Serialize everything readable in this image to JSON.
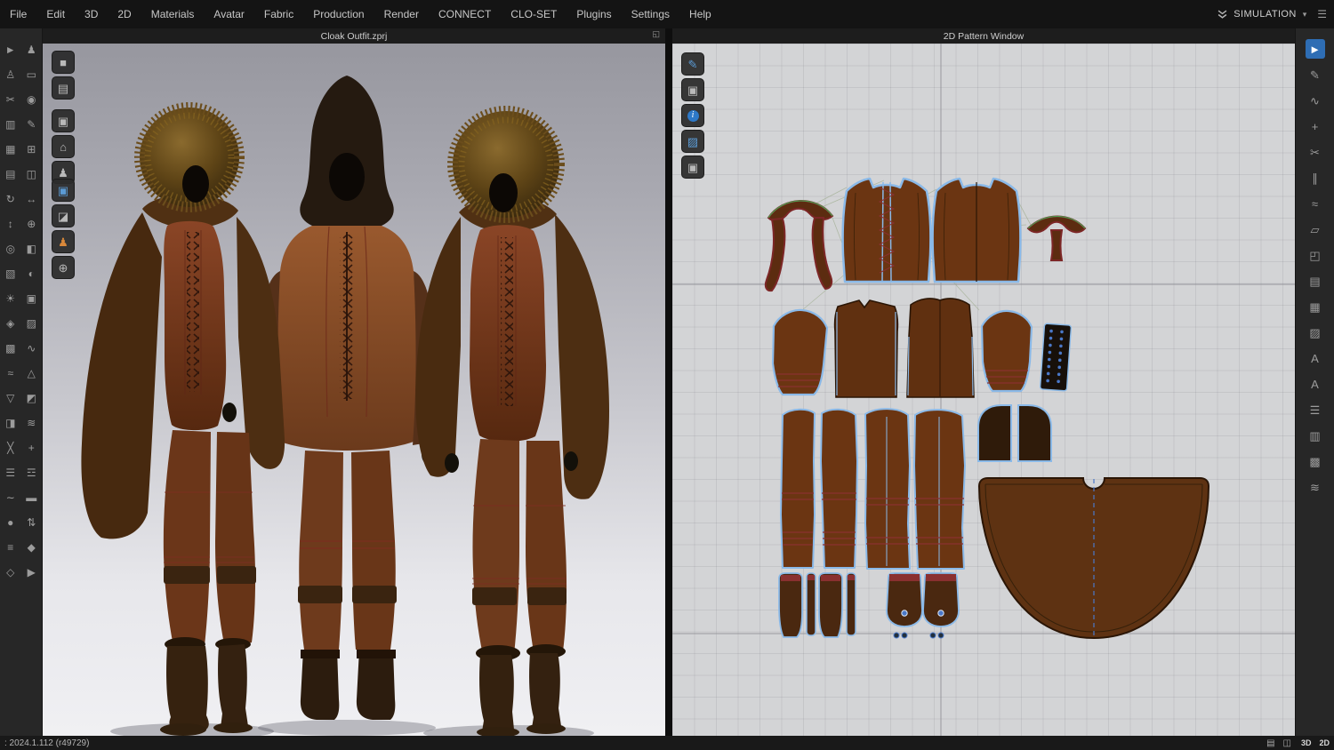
{
  "colors": {
    "accent": "#2e6db4",
    "grid_bg": "#d3d4d6",
    "pattern_outline_blue": "#8ab9e8",
    "leather_brown": "#6b3512",
    "leather_dark": "#3a2008",
    "cloak_brown": "#5e3212",
    "seam_red": "#8a3030",
    "eyelet_blue": "#4a78c8",
    "fur_brown": "#6a4d1e",
    "relation_green": "#4e9a4e"
  },
  "menubar": {
    "items": [
      {
        "name": "menu-file",
        "label": "File"
      },
      {
        "name": "menu-edit",
        "label": "Edit"
      },
      {
        "name": "menu-3d",
        "label": "3D"
      },
      {
        "name": "menu-2d",
        "label": "2D"
      },
      {
        "name": "menu-materials",
        "label": "Materials"
      },
      {
        "name": "menu-avatar",
        "label": "Avatar"
      },
      {
        "name": "menu-fabric",
        "label": "Fabric"
      },
      {
        "name": "menu-production",
        "label": "Production"
      },
      {
        "name": "menu-render",
        "label": "Render"
      },
      {
        "name": "menu-connect",
        "label": "CONNECT"
      },
      {
        "name": "menu-clo-set",
        "label": "CLO-SET"
      },
      {
        "name": "menu-plugins",
        "label": "Plugins"
      },
      {
        "name": "menu-settings",
        "label": "Settings"
      },
      {
        "name": "menu-help",
        "label": "Help"
      }
    ],
    "simulation_label": "SIMULATION",
    "caret_glyph": "▾",
    "panel_glyph": "☰"
  },
  "windows": {
    "viewport3d": {
      "title": "Cloak Outfit.zprj",
      "undock_glyph": "◱"
    },
    "pattern2d": {
      "title": "2D Pattern Window"
    }
  },
  "toolbars": {
    "left": [
      {
        "name": "select-tool-icon",
        "glyph": "►"
      },
      {
        "name": "avatar-show-icon",
        "glyph": "♟"
      },
      {
        "name": "pose-tool-icon",
        "glyph": "♙"
      },
      {
        "name": "tape-measure-icon",
        "glyph": "▭"
      },
      {
        "name": "scissors-tool-icon",
        "glyph": "✂"
      },
      {
        "name": "pin-tool-icon",
        "glyph": "◉"
      },
      {
        "name": "ruler-tool-icon",
        "glyph": "▥"
      },
      {
        "name": "pen-tool-icon",
        "glyph": "✎"
      },
      {
        "name": "grid-tool-icon",
        "glyph": "▦"
      },
      {
        "name": "box-select-icon",
        "glyph": "⊞"
      },
      {
        "name": "layers-tool-icon",
        "glyph": "▤"
      },
      {
        "name": "mirror-tool-icon",
        "glyph": "◫"
      },
      {
        "name": "rotate-tool-icon",
        "glyph": "↻"
      },
      {
        "name": "move-tool-icon",
        "glyph": "↔"
      },
      {
        "name": "scale-tool-icon",
        "glyph": "↕"
      },
      {
        "name": "zoom-tool-icon",
        "glyph": "⊕"
      },
      {
        "name": "orbit-tool-icon",
        "glyph": "◎"
      },
      {
        "name": "section-tool-icon",
        "glyph": "◧"
      },
      {
        "name": "wireframe-toggle-icon",
        "glyph": "▧"
      },
      {
        "name": "shading-toggle-icon",
        "glyph": "◐"
      },
      {
        "name": "light-tool-icon",
        "glyph": "☀"
      },
      {
        "name": "camera-tool-icon",
        "glyph": "▣"
      },
      {
        "name": "render-tool-icon",
        "glyph": "◈"
      },
      {
        "name": "fabric-tool-icon",
        "glyph": "▨"
      },
      {
        "name": "pattern-tool-icon",
        "glyph": "▩"
      },
      {
        "name": "sewing-tool-icon",
        "glyph": "∿"
      },
      {
        "name": "seam-tool-icon",
        "glyph": "≈"
      },
      {
        "name": "dart-tool-icon",
        "glyph": "△"
      },
      {
        "name": "notch-tool-icon",
        "glyph": "▽"
      },
      {
        "name": "fold-tool-icon",
        "glyph": "◩"
      },
      {
        "name": "flip-tool-icon",
        "glyph": "◨"
      },
      {
        "name": "stitch-tool-icon",
        "glyph": "≋"
      },
      {
        "name": "trim-tool-icon",
        "glyph": "╳"
      },
      {
        "name": "tack-tool-icon",
        "glyph": "+"
      },
      {
        "name": "pleat-tool-icon",
        "glyph": "☰"
      },
      {
        "name": "gather-tool-icon",
        "glyph": "☲"
      },
      {
        "name": "elastic-tool-icon",
        "glyph": "∼"
      },
      {
        "name": "belt-tool-icon",
        "glyph": "▬"
      },
      {
        "name": "button-tool-icon",
        "glyph": "●"
      },
      {
        "name": "zipper-tool-icon",
        "glyph": "⇅"
      },
      {
        "name": "steam-tool-icon",
        "glyph": "≡"
      },
      {
        "name": "solidify-tool-icon",
        "glyph": "◆"
      },
      {
        "name": "uv-tool-icon",
        "glyph": "◇"
      },
      {
        "name": "export-tool-icon",
        "glyph": "▶"
      }
    ],
    "view3d_display": [
      {
        "name": "view-mode-icon",
        "glyph": "■"
      },
      {
        "name": "show-avatar-icon",
        "glyph": "▤"
      }
    ],
    "view3d_garment": [
      {
        "name": "show-garment-icon",
        "glyph": "▣"
      },
      {
        "name": "arrangement-icon",
        "glyph": "⌂"
      },
      {
        "name": "avatar-display-icon",
        "glyph": "♟"
      }
    ],
    "view3d_simulate": [
      {
        "name": "simulate-garment-icon",
        "glyph": "▣",
        "variant": "blue"
      },
      {
        "name": "jacket-display-icon",
        "glyph": "◪"
      },
      {
        "name": "avatar-pose-icon",
        "glyph": "♟",
        "variant": "orange"
      },
      {
        "name": "globe-environment-icon",
        "glyph": "⊕"
      }
    ],
    "view2d": [
      {
        "name": "needle-awl-icon",
        "glyph": "✎",
        "variant": "blue"
      },
      {
        "name": "show-garment-2d-icon",
        "glyph": "▣"
      },
      {
        "name": "pattern-info-icon",
        "glyph": "i",
        "variant": "info"
      },
      {
        "name": "fabric-view-icon",
        "glyph": "▨",
        "variant": "blue"
      },
      {
        "name": "show-base-pattern-icon",
        "glyph": "▣"
      }
    ],
    "right": [
      {
        "name": "transform-pattern-icon",
        "glyph": "►",
        "variant": "active"
      },
      {
        "name": "edit-pattern-icon",
        "glyph": "✎"
      },
      {
        "name": "edit-curvature-icon",
        "glyph": "∿"
      },
      {
        "name": "add-point-icon",
        "glyph": "+"
      },
      {
        "name": "cut-sew-icon",
        "glyph": "✂"
      },
      {
        "name": "segment-sewing-icon",
        "glyph": "∥"
      },
      {
        "name": "free-sewing-icon",
        "glyph": "≈"
      },
      {
        "name": "internal-polygon-icon",
        "glyph": "▱"
      },
      {
        "name": "trace-tool-icon",
        "glyph": "◰"
      },
      {
        "name": "grading-tool-icon",
        "glyph": "▤"
      },
      {
        "name": "texture-editor-icon",
        "glyph": "▦"
      },
      {
        "name": "fabric-swatch-icon",
        "glyph": "▨"
      },
      {
        "name": "text-tool-icon",
        "glyph": "A"
      },
      {
        "name": "monogram-tool-icon",
        "glyph": "A"
      },
      {
        "name": "baseline-tool-icon",
        "glyph": "☰"
      },
      {
        "name": "ruler-2d-icon",
        "glyph": "▥"
      },
      {
        "name": "show-grid-icon",
        "glyph": "▩"
      },
      {
        "name": "steam-2d-icon",
        "glyph": "≋"
      }
    ]
  },
  "statusbar": {
    "version": ": 2024.1.112 (r49729)",
    "right_items": [
      {
        "name": "pane-layout-icon",
        "glyph": "▤"
      },
      {
        "name": "split-view-icon",
        "glyph": "◫"
      },
      {
        "name": "badge-3d",
        "label": "3D"
      },
      {
        "name": "badge-2d",
        "label": "2D"
      }
    ]
  }
}
